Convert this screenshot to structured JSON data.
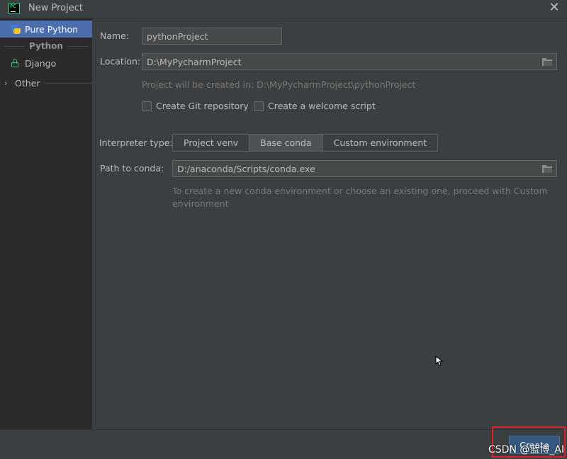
{
  "window": {
    "title": "New Project",
    "app_icon_text": "PC"
  },
  "sidebar": {
    "items": [
      {
        "label": "Pure Python",
        "icon": "python-icon",
        "selected": true
      },
      {
        "label": "Django",
        "icon": "lock-icon",
        "selected": false
      }
    ],
    "section_header": "Python",
    "other_label": "Other"
  },
  "form": {
    "name_label": "Name:",
    "name_value": "pythonProject",
    "location_label": "Location:",
    "location_value": "D:\\MyPycharmProject",
    "created_in_hint": "Project will be created in: D:\\MyPycharmProject\\pythonProject",
    "git_checkbox_label": "Create Git repository",
    "welcome_checkbox_label": "Create a welcome script",
    "interpreter_label": "Interpreter type:",
    "interpreter_options": [
      "Project venv",
      "Base conda",
      "Custom environment"
    ],
    "interpreter_selected": "Base conda",
    "conda_path_label": "Path to conda:",
    "conda_path_value": "D:/anaconda/Scripts/conda.exe",
    "conda_hint_line1": "To create a new conda environment or choose an existing one, proceed with Custom",
    "conda_hint_line2": "environment"
  },
  "footer": {
    "create_label": "Create"
  },
  "watermark": "CSDN @蓝博_AI",
  "colors": {
    "selection": "#4b6eaf",
    "primary_button": "#365880",
    "highlight": "#e0202a"
  }
}
